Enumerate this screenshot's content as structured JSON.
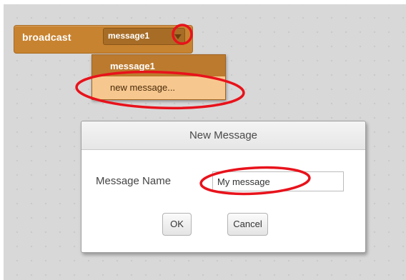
{
  "block": {
    "label": "broadcast",
    "selected_message": "message1",
    "color": "#c88330"
  },
  "menu": {
    "items": [
      {
        "label": "message1"
      },
      {
        "label": "new message..."
      }
    ],
    "highlight_color": "#f6c88f"
  },
  "dialog": {
    "title": "New Message",
    "field_label": "Message Name",
    "field_value": "My message",
    "ok_label": "OK",
    "cancel_label": "Cancel"
  },
  "annotation": {
    "color": "#e8121b"
  }
}
